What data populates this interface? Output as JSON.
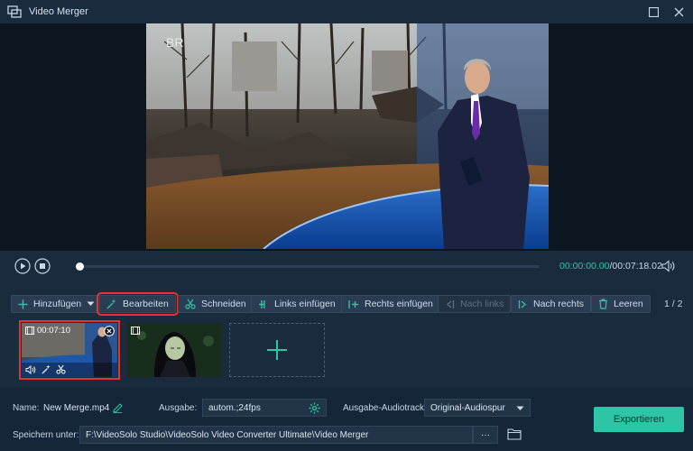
{
  "window": {
    "title": "Video Merger"
  },
  "player": {
    "current_time": "00:00:00.00",
    "total_time": "/00:07:18.02",
    "progress": 0.0
  },
  "toolbar": {
    "add": "Hinzufügen",
    "edit": "Bearbeiten",
    "cut": "Schneiden",
    "insert_left": "Links einfügen",
    "insert_right": "Rechts einfügen",
    "move_left": "Nach links",
    "move_right": "Nach rechts",
    "clear": "Leeren",
    "page": "1 / 2"
  },
  "clips": [
    {
      "duration": "00:07:10"
    },
    {
      "duration": ""
    }
  ],
  "bottom": {
    "name_label": "Name:",
    "name_value": "New Merge.mp4",
    "output_label": "Ausgabe:",
    "output_value": "autom.;24fps",
    "audio_label": "Ausgabe-Audiotrack:",
    "audio_value": "Original-Audiospur",
    "save_label": "Speichern unter:",
    "save_path": "F:\\VideoSolo Studio\\VideoSolo Video Converter Ultimate\\Video Merger",
    "more": "···",
    "export": "Exportieren"
  },
  "colors": {
    "accent": "#2ec4a6",
    "highlight": "#e3342f",
    "background": "#1a2b3d"
  }
}
